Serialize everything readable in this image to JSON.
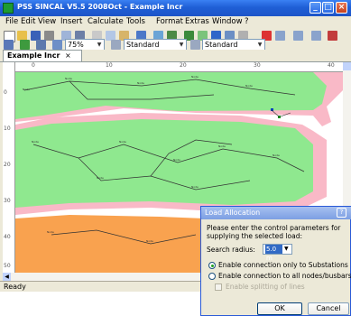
{
  "window": {
    "title": "PSS SINCAL V5.5 2008Oct - Example Incr",
    "controls": {
      "minimize": "_",
      "maximize": "□",
      "close": "×"
    }
  },
  "menu": [
    "File",
    "Edit",
    "View",
    "Insert",
    "Calculate",
    "Tools",
    "Format",
    "Extras",
    "Window",
    "?"
  ],
  "toolbar": {
    "zoom": "75%",
    "style_combo_1": "Standard",
    "style_combo_2": "Standard"
  },
  "tab": {
    "label": "Example Incr",
    "close": "×"
  },
  "ruler_top": [
    "0",
    "10",
    "20",
    "30",
    "40"
  ],
  "ruler_left": [
    "0",
    "10",
    "20",
    "30",
    "40",
    "50"
  ],
  "status": {
    "text": "Ready"
  },
  "dialog": {
    "title": "Load Allocation",
    "help": "?",
    "description": "Please enter the control parameters for supplying the selected load:",
    "search_radius_label": "Search radius:",
    "search_radius_value": "5.0 m",
    "option_substations": "Enable connection only to Substations",
    "option_all_nodes": "Enable connection to all nodes/busbars",
    "option_splitting": "Enable splitting of lines",
    "ok_label": "OK",
    "cancel_label": "Cancel"
  },
  "colors": {
    "zone_pink": "#f9b9c7",
    "zone_green": "#8fe88f",
    "zone_orange": "#f9a24f",
    "title_blue": "#1f5fd6"
  }
}
